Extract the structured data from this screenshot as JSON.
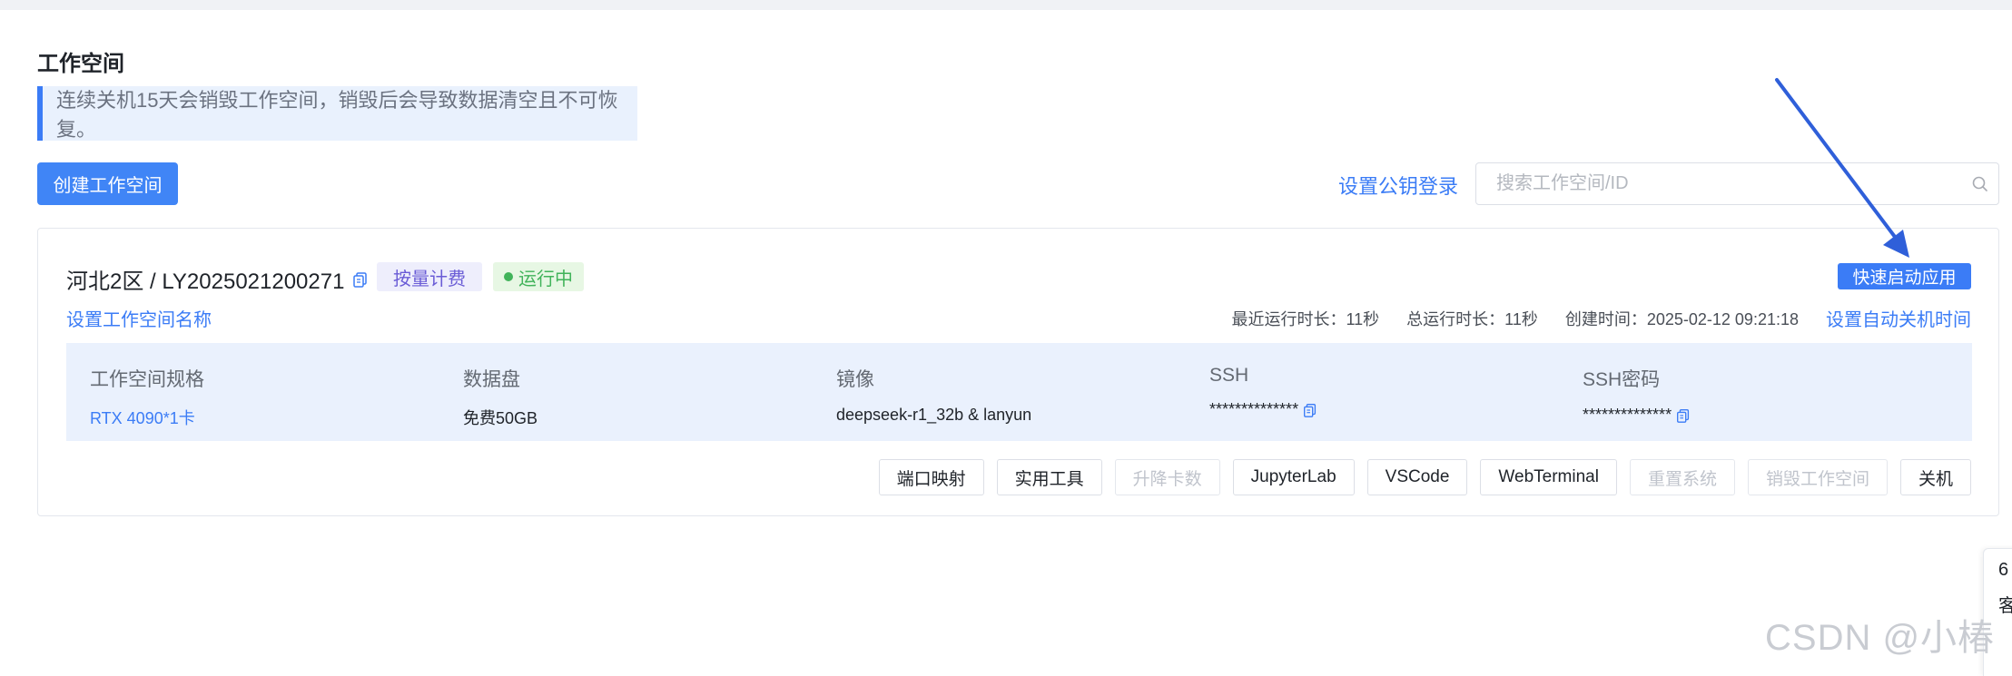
{
  "page": {
    "title": "工作空间",
    "notice": "连续关机15天会销毁工作空间，销毁后会导致数据清空且不可恢复。",
    "create_button": "创建工作空间",
    "pubkey_link": "设置公钥登录",
    "search_placeholder": "搜索工作空间/ID"
  },
  "workspace": {
    "title": "河北2区 / LY2025021200271",
    "billing_tag": "按量计费",
    "status_tag": "运行中",
    "quickstart_button": "快速启动应用",
    "rename_link": "设置工作空间名称",
    "meta": {
      "recent_runtime": "最近运行时长：11秒",
      "total_runtime": "总运行时长：11秒",
      "created": "创建时间：2025-02-12 09:21:18",
      "autoshutdown_link": "设置自动关机时间"
    },
    "specs": [
      {
        "label": "工作空间规格",
        "value": "RTX 4090*1卡"
      },
      {
        "label": "数据盘",
        "value": "免费50GB"
      },
      {
        "label": "镜像",
        "value": "deepseek-r1_32b & lanyun"
      },
      {
        "label": "SSH",
        "value": "**************"
      },
      {
        "label": "SSH密码",
        "value": "**************"
      }
    ],
    "actions": [
      {
        "label": "端口映射",
        "disabled": false
      },
      {
        "label": "实用工具",
        "disabled": false
      },
      {
        "label": "升降卡数",
        "disabled": true
      },
      {
        "label": "JupyterLab",
        "disabled": false
      },
      {
        "label": "VSCode",
        "disabled": false
      },
      {
        "label": "WebTerminal",
        "disabled": false
      },
      {
        "label": "重置系统",
        "disabled": true
      },
      {
        "label": "销毁工作空间",
        "disabled": true
      },
      {
        "label": "关机",
        "disabled": false
      }
    ]
  },
  "side_widget": {
    "line1": "6",
    "line2": "客"
  },
  "watermark": "CSDN @小椿",
  "colors": {
    "accent": "#3b7cf6",
    "running": "#41b35a",
    "billing": "#6a5cd6",
    "arrow": "#2f5fd9"
  }
}
